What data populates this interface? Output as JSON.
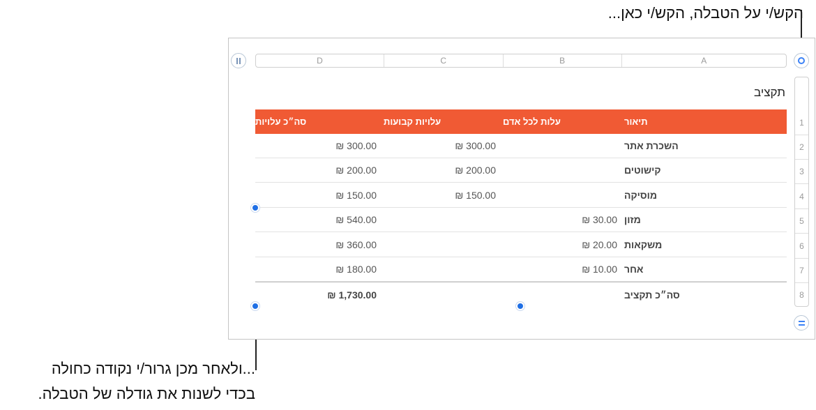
{
  "callouts": {
    "top": "הקש/י על הטבלה, הקש/י כאן...",
    "bottom_line1": "...ולאחר מכן גרור/י נקודה כחולה",
    "bottom_line2": "בכדי לשנות את גודלה של הטבלה."
  },
  "icons": {
    "freeze": "pause-icon",
    "select_table": "circle-icon",
    "add_rows": "equals-icon"
  },
  "columns": [
    "D",
    "C",
    "B",
    "A"
  ],
  "rows": [
    "1",
    "2",
    "3",
    "4",
    "5",
    "6",
    "7",
    "8"
  ],
  "table": {
    "title": "תקציב",
    "header": {
      "description": "תיאור",
      "per_person": "עלות לכל אדם",
      "fixed": "עלויות קבועות",
      "total": "סה״כ עלויות"
    },
    "body": [
      {
        "description": "השכרת אתר",
        "per_person": "",
        "fixed": "₪ 300.00",
        "total": "₪ 300.00"
      },
      {
        "description": "קישוטים",
        "per_person": "",
        "fixed": "₪ 200.00",
        "total": "₪ 200.00"
      },
      {
        "description": "מוסיקה",
        "per_person": "",
        "fixed": "₪ 150.00",
        "total": "₪ 150.00"
      },
      {
        "description": "מזון",
        "per_person": "₪ 30.00",
        "fixed": "",
        "total": "₪ 540.00"
      },
      {
        "description": "משקאות",
        "per_person": "₪ 20.00",
        "fixed": "",
        "total": "₪ 360.00"
      },
      {
        "description": "אחר",
        "per_person": "₪ 10.00",
        "fixed": "",
        "total": "₪ 180.00"
      }
    ],
    "footer": {
      "description": "סה״כ תקציב",
      "per_person": "",
      "fixed": "",
      "total": "₪ 1,730.00"
    }
  },
  "colors": {
    "header_bg": "#f05a34",
    "handle": "#1f6fe5",
    "accent": "#3b82f6"
  }
}
